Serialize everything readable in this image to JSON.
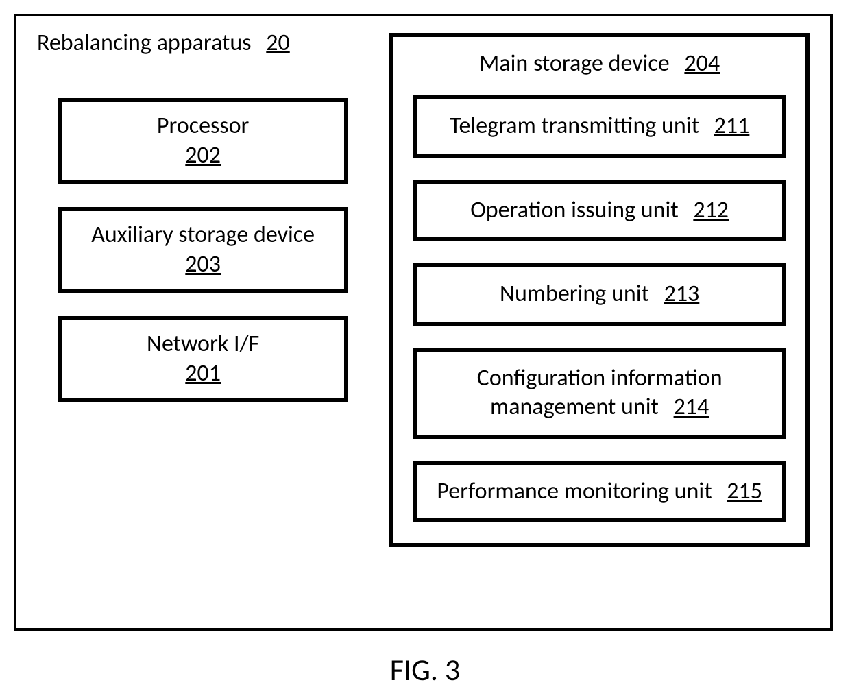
{
  "outer": {
    "title": "Rebalancing apparatus",
    "ref": "20"
  },
  "left": [
    {
      "label": "Processor",
      "ref": "202"
    },
    {
      "label": "Auxiliary storage device",
      "ref": "203"
    },
    {
      "label": "Network I/F",
      "ref": "201"
    }
  ],
  "main_storage": {
    "title": "Main storage device",
    "ref": "204",
    "units": [
      {
        "label": "Telegram transmitting unit",
        "ref": "211"
      },
      {
        "label": "Operation issuing unit",
        "ref": "212"
      },
      {
        "label": "Numbering unit",
        "ref": "213"
      },
      {
        "label": "Configuration information management unit",
        "ref": "214"
      },
      {
        "label": "Performance monitoring unit",
        "ref": "215"
      }
    ]
  },
  "caption": "FIG. 3"
}
